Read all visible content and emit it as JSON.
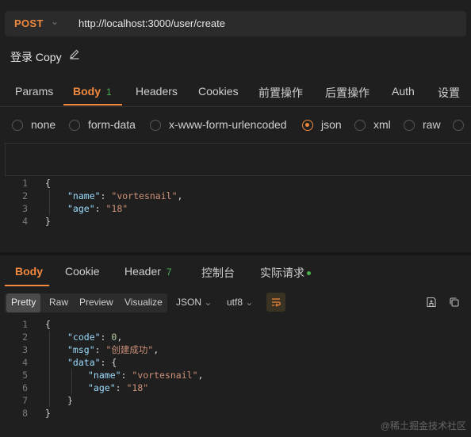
{
  "request": {
    "method": "POST",
    "url": "http://localhost:3000/user/create",
    "title": "登录 Copy"
  },
  "request_tabs": [
    {
      "label": "Params"
    },
    {
      "label": "Body",
      "badge": "1"
    },
    {
      "label": "Headers"
    },
    {
      "label": "Cookies"
    },
    {
      "label": "前置操作"
    },
    {
      "label": "后置操作"
    },
    {
      "label": "Auth"
    },
    {
      "label": "设置"
    }
  ],
  "body_types": [
    {
      "label": "none"
    },
    {
      "label": "form-data"
    },
    {
      "label": "x-www-form-urlencoded"
    },
    {
      "label": "json",
      "selected": true
    },
    {
      "label": "xml"
    },
    {
      "label": "raw"
    }
  ],
  "request_body": {
    "line_numbers": [
      "1",
      "2",
      "3",
      "4"
    ],
    "open_brace": "{",
    "name_key": "\"name\"",
    "name_value": "\"vortesnail\"",
    "age_key": "\"age\"",
    "age_value": "\"18\"",
    "close_brace": "}"
  },
  "response_tabs": [
    {
      "label": "Body"
    },
    {
      "label": "Cookie"
    },
    {
      "label": "Header",
      "badge": "7"
    },
    {
      "label": "控制台"
    },
    {
      "label": "实际请求"
    }
  ],
  "view_modes": [
    "Pretty",
    "Raw",
    "Preview",
    "Visualize"
  ],
  "format_select": "JSON",
  "encoding_select": "utf8",
  "response_body": {
    "line_numbers": [
      "1",
      "2",
      "3",
      "4",
      "5",
      "6",
      "7",
      "8"
    ],
    "code_key": "\"code\"",
    "code_value": "0",
    "msg_key": "\"msg\"",
    "msg_value": "\"创建成功\"",
    "data_key": "\"data\"",
    "name_key": "\"name\"",
    "name_value": "\"vortesnail\"",
    "age_key": "\"age\"",
    "age_value": "\"18\""
  },
  "watermark": "@稀土掘金技术社区",
  "colors": {
    "accent": "#f0883e",
    "badge": "#4caf50",
    "background": "#1f1f1f"
  }
}
